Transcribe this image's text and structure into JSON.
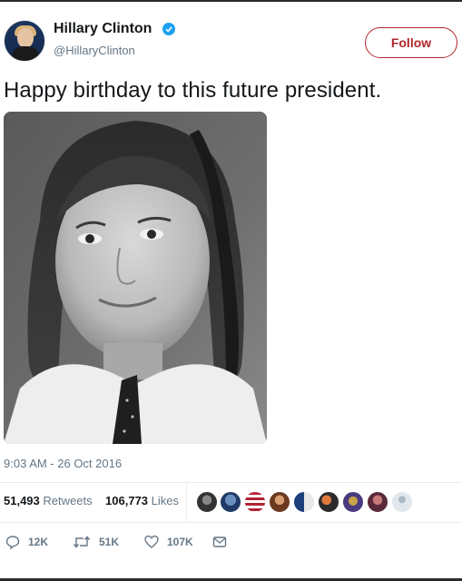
{
  "author": {
    "name": "Hillary Clinton",
    "handle": "@HillaryClinton",
    "verified": true,
    "avatar_icon": "avatar-photo"
  },
  "follow_label": "Follow",
  "tweet": {
    "text": "Happy birthday to this future president.",
    "timestamp": "9:03 AM - 26 Oct 2016"
  },
  "stats": {
    "retweets": "51,493",
    "retweets_label": "Retweets",
    "likes": "106,773",
    "likes_label": "Likes"
  },
  "actions": {
    "reply_count": "12K",
    "retweet_count": "51K",
    "like_count": "107K"
  },
  "colors": {
    "accent_red": "#b0282c",
    "verified_blue": "#1da1f2",
    "muted": "#657786"
  }
}
